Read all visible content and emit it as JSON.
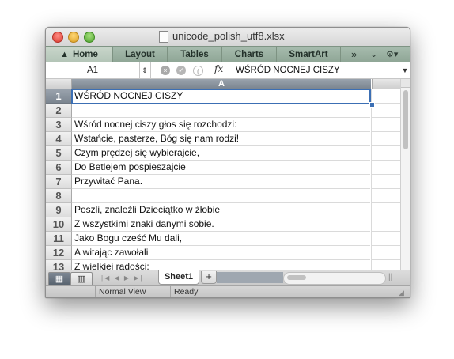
{
  "window": {
    "title": "unicode_polish_utf8.xlsx"
  },
  "ribbon": {
    "tabs": [
      "Home",
      "Layout",
      "Tables",
      "Charts",
      "SmartArt"
    ],
    "overflow_glyph": "»",
    "collapse_glyph": "⌄",
    "settings_glyph": "⚙▾"
  },
  "formula_bar": {
    "name_box": "A1",
    "fx_label": "fx",
    "value": "WŚRÓD NOCNEJ CISZY"
  },
  "grid": {
    "column_header": "A",
    "rows": [
      {
        "num": "1",
        "text": "WŚRÓD NOCNEJ CISZY"
      },
      {
        "num": "2",
        "text": ""
      },
      {
        "num": "3",
        "text": "Wśród nocnej ciszy głos się rozchodzi:"
      },
      {
        "num": "4",
        "text": "Wstańcie, pasterze, Bóg się nam rodzi!"
      },
      {
        "num": "5",
        "text": "Czym prędzej się wybierajcie,"
      },
      {
        "num": "6",
        "text": "Do Betlejem pospieszajcie"
      },
      {
        "num": "7",
        "text": "Przywitać Pana."
      },
      {
        "num": "8",
        "text": ""
      },
      {
        "num": "9",
        "text": "Poszli, znaleźli Dzieciątko w żłobie"
      },
      {
        "num": "10",
        "text": "Z wszystkimi znaki danymi sobie."
      },
      {
        "num": "11",
        "text": "Jako Bogu cześć Mu dali,"
      },
      {
        "num": "12",
        "text": "A witając zawołali"
      },
      {
        "num": "13",
        "text": "Z wielkiej radości:"
      }
    ]
  },
  "sheets": {
    "active": "Sheet1",
    "add_label": "+"
  },
  "status": {
    "view": "Normal View",
    "state": "Ready"
  }
}
